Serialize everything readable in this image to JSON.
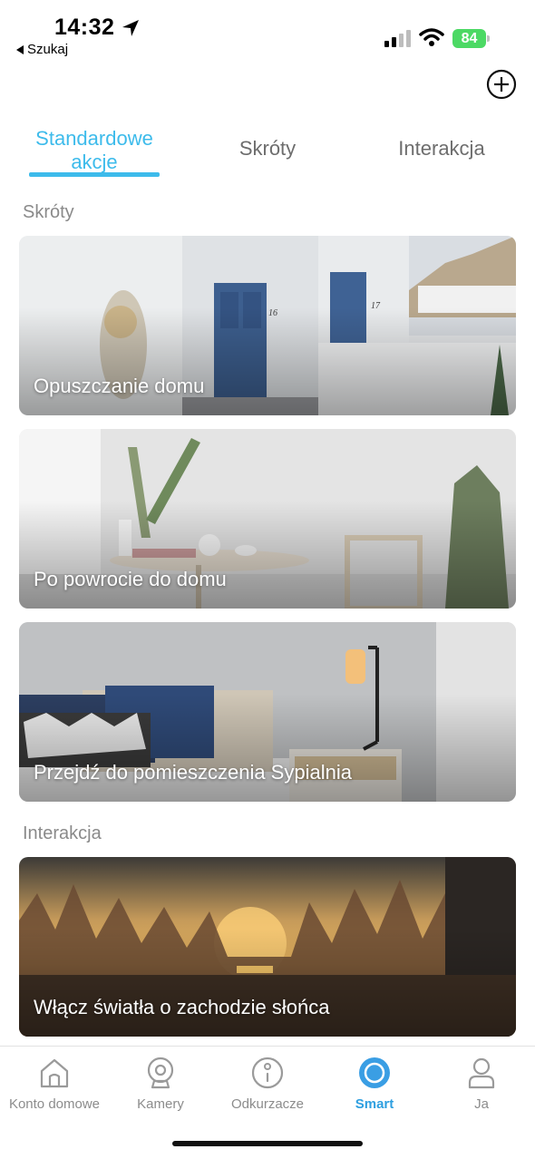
{
  "status_bar": {
    "time": "14:32",
    "back_label": "Szukaj",
    "battery": "84",
    "battery_color": "#4cd964"
  },
  "header": {
    "add_icon": "plus-circle-icon"
  },
  "tabs": [
    {
      "label": "Standardowe akcje",
      "active": true
    },
    {
      "label": "Skróty",
      "active": false
    },
    {
      "label": "Interakcja",
      "active": false
    }
  ],
  "sections": {
    "shortcuts_label": "Skróty",
    "interaction_label": "Interakcja"
  },
  "cards": [
    {
      "title": "Opuszczanie domu"
    },
    {
      "title": "Po powrocie do domu"
    },
    {
      "title": "Przejdź do pomieszczenia Sypialnia"
    },
    {
      "title": "Włącz światła o zachodzie słońca"
    }
  ],
  "scene_text": {
    "door_1": "16",
    "door_2": "17"
  },
  "bottom_nav": [
    {
      "label": "Konto domowe",
      "icon": "home-icon",
      "active": false
    },
    {
      "label": "Kamery",
      "icon": "camera-icon",
      "active": false
    },
    {
      "label": "Odkurzacze",
      "icon": "robot-vacuum-icon",
      "active": false
    },
    {
      "label": "Smart",
      "icon": "smart-circle-icon",
      "active": true
    },
    {
      "label": "Ja",
      "icon": "person-icon",
      "active": false
    }
  ],
  "colors": {
    "accent": "#3dbbeb",
    "nav_active": "#2e9fe0",
    "inactive_text": "#6d6d6d"
  }
}
